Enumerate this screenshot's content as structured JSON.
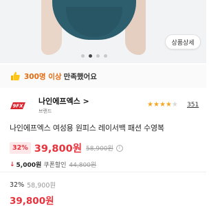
{
  "gallery": {
    "detail_button": "상품상세",
    "dots": 4,
    "active_dot": 1
  },
  "satisfaction": {
    "count": "300명 이상",
    "rest": "만족했어요"
  },
  "brand": {
    "logo_text": "9FX",
    "name": "나인에프엑스 >",
    "sub_label": "브랜드",
    "rating_stars": 4.5,
    "review_count": "351"
  },
  "product": {
    "title": "나인에프엑스 여성용 원피스 레이서백 패션 수영복"
  },
  "price": {
    "discount": "32%",
    "sale_price": "39,800원",
    "original_price": "58,900원",
    "info_icon": "i"
  },
  "coupon": {
    "arrow": "↓",
    "amount": "5,000원",
    "label": "쿠폰할인",
    "original_price": "44,800원"
  },
  "lower": {
    "discount": "32%",
    "original_price": "58,900원",
    "final_price": "39,800원"
  },
  "colors": {
    "accent_red": "#e8323c",
    "satisfaction_orange": "#e46b0f",
    "star_gold": "#f5a623",
    "swimsuit_teal": "#2d5e6e"
  }
}
